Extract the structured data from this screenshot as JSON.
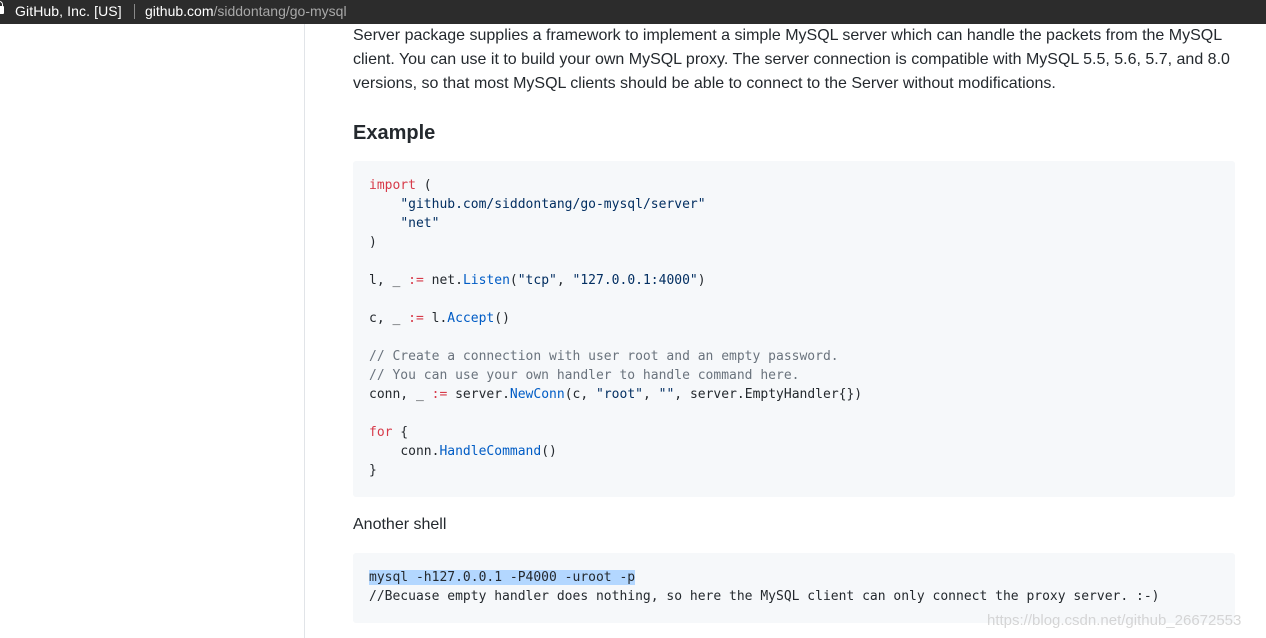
{
  "browser": {
    "cert_label": "GitHub, Inc. [US]",
    "url_host": "github.com",
    "url_path": "/siddontang/go-mysql"
  },
  "content": {
    "intro": "Server package supplies a framework to implement a simple MySQL server which can handle the packets from the MySQL client. You can use it to build your own MySQL proxy. The server connection is compatible with MySQL 5.5, 5.6, 5.7, and 8.0 versions, so that most MySQL clients should be able to connect to the Server without modifications.",
    "example_heading": "Example",
    "code1": {
      "import_kw": "import",
      "import_open": " (",
      "pkg_server": "\"github.com/siddontang/go-mysql/server\"",
      "pkg_net": "\"net\"",
      "import_close": ")",
      "listen_lhs": "l, _ ",
      "listen_op": ":=",
      "listen_obj": " net.",
      "listen_fn": "Listen",
      "listen_args_open": "(",
      "listen_arg1": "\"tcp\"",
      "listen_comma": ", ",
      "listen_arg2": "\"127.0.0.1:4000\"",
      "listen_args_close": ")",
      "accept_lhs": "c, _ ",
      "accept_op": ":=",
      "accept_obj": " l.",
      "accept_fn": "Accept",
      "accept_args": "()",
      "comment1": "// Create a connection with user root and an empty password.",
      "comment2": "// You can use your own handler to handle command here.",
      "conn_lhs": "conn, _ ",
      "conn_op": ":=",
      "conn_obj": " server.",
      "conn_fn": "NewConn",
      "conn_args_open": "(c, ",
      "conn_arg_root": "\"root\"",
      "conn_comma": ", ",
      "conn_arg_empty": "\"\"",
      "conn_args_rest": ", server.EmptyHandler{})",
      "for_kw": "for",
      "for_open": " {",
      "handle_obj": "conn.",
      "handle_fn": "HandleCommand",
      "handle_args": "()",
      "for_close": "}"
    },
    "another_shell": "Another shell",
    "code2": {
      "cmd": "mysql -h127.0.0.1 -P4000 -uroot -p",
      "comment": "//Becuase empty handler does nothing, so here the MySQL client can only connect the proxy server. :-)"
    }
  },
  "watermark": "https://blog.csdn.net/github_26672553"
}
